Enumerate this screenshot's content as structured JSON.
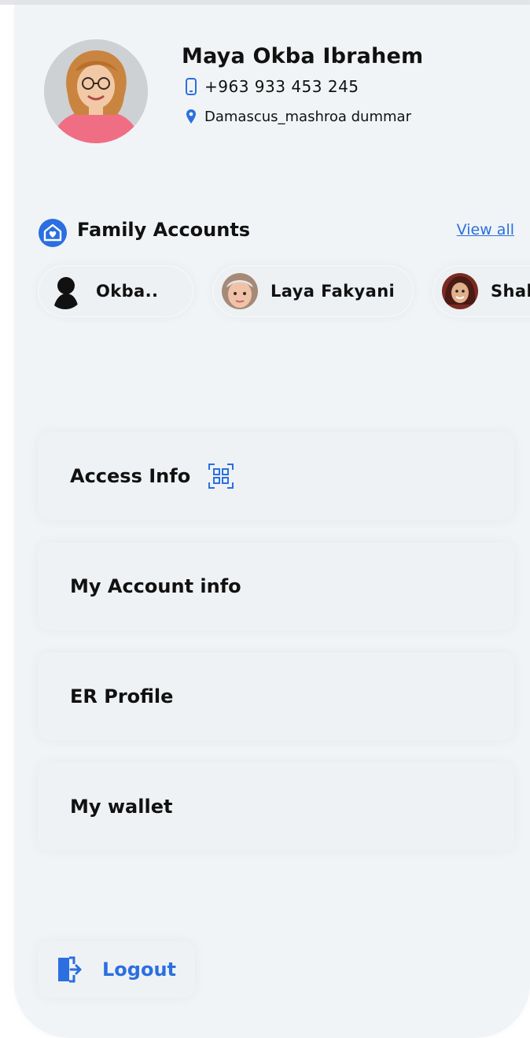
{
  "profile": {
    "name": "Maya Okba Ibrahem",
    "phone": "+963 933 453 245",
    "address": "Damascus_mashroa dummar"
  },
  "family": {
    "title": "Family Accounts",
    "view_all": "View all",
    "members": [
      {
        "name": "Okba.."
      },
      {
        "name": "Laya Fakyani"
      },
      {
        "name": "Shal"
      }
    ]
  },
  "menu": {
    "items": [
      {
        "label": "Access Info"
      },
      {
        "label": "My Account info"
      },
      {
        "label": "ER Profile"
      },
      {
        "label": "My wallet"
      }
    ]
  },
  "logout": {
    "label": "Logout"
  },
  "colors": {
    "accent": "#2b6fe0",
    "panel": "#f1f4f6",
    "text": "#111111"
  },
  "icons": [
    "phone-icon",
    "location-pin-icon",
    "family-heart-icon",
    "qr-code-icon",
    "logout-icon"
  ]
}
